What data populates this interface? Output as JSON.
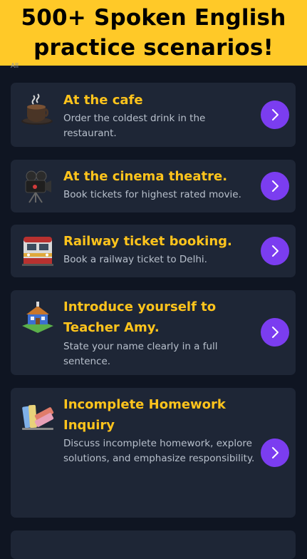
{
  "banner": {
    "line1": "500+ Spoken English",
    "line2": "practice scenarios!"
  },
  "header_partial_text": "All",
  "colors": {
    "accent": "#ffc928",
    "card": "#1e2636",
    "background": "#0f1522",
    "title": "#ffc41c",
    "button": "#7b3df0"
  },
  "scenarios": [
    {
      "title": "At the cafe",
      "description": "Order the coldest drink in the restaurant.",
      "icon": "coffee-cup-icon"
    },
    {
      "title": "At the cinema theatre.",
      "description": "Book tickets for highest rated movie.",
      "icon": "movie-camera-icon"
    },
    {
      "title": "Railway ticket booking.",
      "description": "Book a railway ticket to Delhi.",
      "icon": "train-icon"
    },
    {
      "title": "Introduce yourself to Teacher Amy.",
      "description": "State your name clearly in a full sentence.",
      "icon": "school-building-icon"
    },
    {
      "title": "Incomplete Homework Inquiry",
      "description": "Discuss incomplete homework, explore solutions, and emphasize responsibility.",
      "icon": "books-icon"
    }
  ]
}
